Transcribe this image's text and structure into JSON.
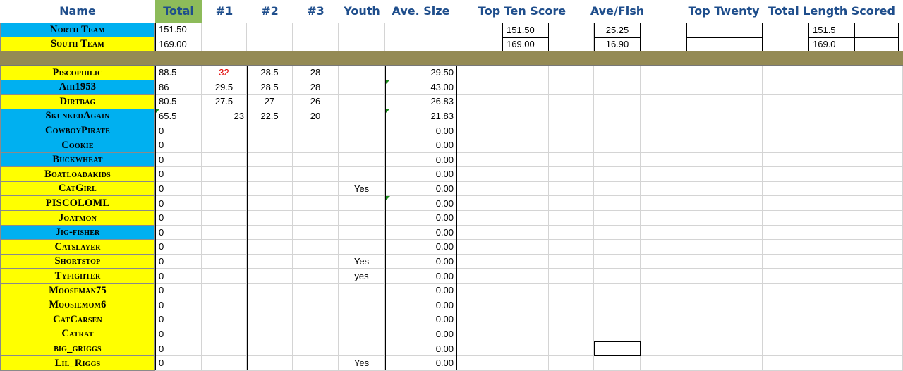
{
  "headers": {
    "name": "Name",
    "total": "Total",
    "f1": "#1",
    "f2": "#2",
    "f3": "#3",
    "youth": "Youth",
    "avesize": "Ave. Size",
    "topten": "Top Ten Score",
    "avefish": "Ave/Fish",
    "toptwenty": "Top Twenty",
    "totallength": "Total Length Scored"
  },
  "teams": [
    {
      "name": "North Team",
      "total": "151.50",
      "topten": "151.50",
      "avefish": "25.25",
      "totallength": "151.5",
      "color": "#00b0f0"
    },
    {
      "name": "South Team",
      "total": "169.00",
      "topten": "169.00",
      "avefish": "16.90",
      "totallength": "169.0",
      "color": "#ffff00"
    }
  ],
  "players": [
    {
      "name": "Piscophilic",
      "color": "#ffff00",
      "total": "88.5",
      "f1": "32",
      "f2": "28.5",
      "f3": "28",
      "youth": "",
      "avesize": "29.50"
    },
    {
      "name": "Ahi1953",
      "color": "#00b0f0",
      "total": "86",
      "f1": "29.5",
      "f2": "28.5",
      "f3": "28",
      "youth": "",
      "avesize": "43.00"
    },
    {
      "name": "Dirtbag",
      "color": "#ffff00",
      "total": "80.5",
      "f1": "27.5",
      "f2": "27",
      "f3": "26",
      "youth": "",
      "avesize": "26.83"
    },
    {
      "name": "SkunkedAgain",
      "color": "#00b0f0",
      "total": "65.5",
      "f1": "23",
      "f2": "22.5",
      "f3": "20",
      "youth": "",
      "avesize": "21.83"
    },
    {
      "name": "CowboyPirate",
      "color": "#00b0f0",
      "total": "0",
      "f1": "",
      "f2": "",
      "f3": "",
      "youth": "",
      "avesize": "0.00"
    },
    {
      "name": "Cookie",
      "color": "#00b0f0",
      "total": "0",
      "f1": "",
      "f2": "",
      "f3": "",
      "youth": "",
      "avesize": "0.00"
    },
    {
      "name": "Buckwheat",
      "color": "#00b0f0",
      "total": "0",
      "f1": "",
      "f2": "",
      "f3": "",
      "youth": "",
      "avesize": "0.00"
    },
    {
      "name": "Boatloadakids",
      "color": "#ffff00",
      "total": "0",
      "f1": "",
      "f2": "",
      "f3": "",
      "youth": "",
      "avesize": "0.00"
    },
    {
      "name": "CatGirl",
      "color": "#ffff00",
      "total": "0",
      "f1": "",
      "f2": "",
      "f3": "",
      "youth": "Yes",
      "avesize": "0.00"
    },
    {
      "name": "PISCOLOML",
      "color": "#ffff00",
      "total": "0",
      "f1": "",
      "f2": "",
      "f3": "",
      "youth": "",
      "avesize": "0.00"
    },
    {
      "name": "Joatmon",
      "color": "#ffff00",
      "total": "0",
      "f1": "",
      "f2": "",
      "f3": "",
      "youth": "",
      "avesize": "0.00"
    },
    {
      "name": "Jig-fisher",
      "color": "#00b0f0",
      "total": "0",
      "f1": "",
      "f2": "",
      "f3": "",
      "youth": "",
      "avesize": "0.00"
    },
    {
      "name": "Catslayer",
      "color": "#ffff00",
      "total": "0",
      "f1": "",
      "f2": "",
      "f3": "",
      "youth": "",
      "avesize": "0.00"
    },
    {
      "name": "Shortstop",
      "color": "#ffff00",
      "total": "0",
      "f1": "",
      "f2": "",
      "f3": "",
      "youth": "Yes",
      "avesize": "0.00"
    },
    {
      "name": "Tyfighter",
      "color": "#ffff00",
      "total": "0",
      "f1": "",
      "f2": "",
      "f3": "",
      "youth": "yes",
      "avesize": "0.00"
    },
    {
      "name": "Mooseman75",
      "color": "#ffff00",
      "total": "0",
      "f1": "",
      "f2": "",
      "f3": "",
      "youth": "",
      "avesize": "0.00"
    },
    {
      "name": "Moosiemom6",
      "color": "#ffff00",
      "total": "0",
      "f1": "",
      "f2": "",
      "f3": "",
      "youth": "",
      "avesize": "0.00"
    },
    {
      "name": "CatCarsen",
      "color": "#ffff00",
      "total": "0",
      "f1": "",
      "f2": "",
      "f3": "",
      "youth": "",
      "avesize": "0.00"
    },
    {
      "name": "Catrat",
      "color": "#ffff00",
      "total": "0",
      "f1": "",
      "f2": "",
      "f3": "",
      "youth": "",
      "avesize": "0.00"
    },
    {
      "name": "big_griggs",
      "color": "#ffff00",
      "total": "0",
      "f1": "",
      "f2": "",
      "f3": "",
      "youth": "",
      "avesize": "0.00"
    },
    {
      "name": "Lil_Riggs",
      "color": "#ffff00",
      "total": "0",
      "f1": "",
      "f2": "",
      "f3": "",
      "youth": "Yes",
      "avesize": "0.00"
    }
  ]
}
